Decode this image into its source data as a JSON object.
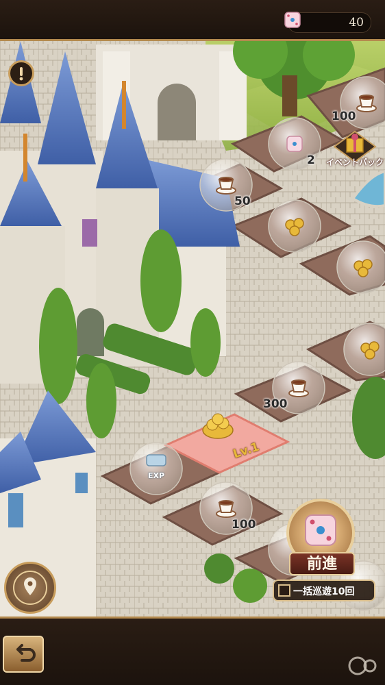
{
  "header": {
    "dice_count": "40",
    "dice_icon": "pink-dice-icon"
  },
  "board": {
    "tiles": [
      {
        "reward": "tea-cup",
        "amount": "100"
      },
      {
        "reward": "dice",
        "amount": "2"
      },
      {
        "reward": "tea-cup",
        "amount": "50"
      },
      {
        "reward": "coins",
        "amount": ""
      },
      {
        "reward": "coins",
        "amount": ""
      },
      {
        "reward": "coins",
        "amount": ""
      },
      {
        "reward": "tea-cup",
        "amount": "300"
      },
      {
        "reward": "exp",
        "amount": ""
      },
      {
        "reward": "tea-cup",
        "amount": "100"
      }
    ],
    "exp_text": "EXP",
    "current_tile_level": "Lv.1",
    "event_pack_label": "イベントパック"
  },
  "controls": {
    "advance_label": "前進",
    "bulk_label": "一括巡遊10回",
    "alert_icon": "exclamation-icon",
    "map_icon": "map-pin-icon",
    "back_icon": "back-arrow-icon"
  },
  "colors": {
    "frame": "#b48a4e",
    "tile": "#8f6b5c",
    "active_tile": "#f2a9a0",
    "roof": "#5b7fc4"
  }
}
